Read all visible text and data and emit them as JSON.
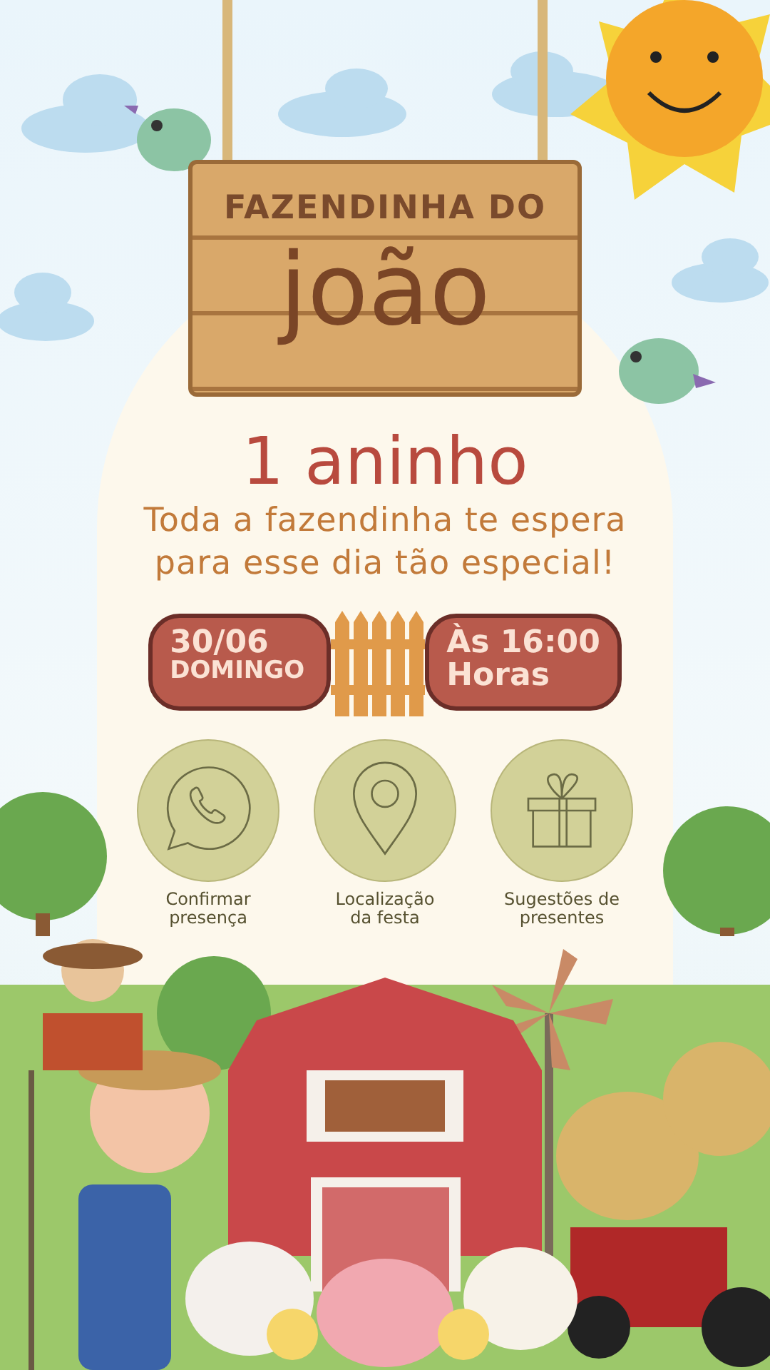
{
  "sign": {
    "line_1": "FAZENDINHA DO",
    "name": "joão"
  },
  "age_title": "1 aninho",
  "message": [
    "Toda a fazendinha te espera",
    "para esse dia tão especial!"
  ],
  "date": {
    "day": "30/06",
    "weekday": "DOMINGO"
  },
  "time": {
    "hour": "Às 16:00",
    "label": "Horas"
  },
  "actions": [
    {
      "kind": "whatsapp",
      "label": [
        "Confirmar",
        "presença"
      ]
    },
    {
      "kind": "location",
      "label": [
        "Localização",
        "da festa"
      ]
    },
    {
      "kind": "gift",
      "label": [
        "Sugestões de",
        "presentes"
      ]
    }
  ]
}
